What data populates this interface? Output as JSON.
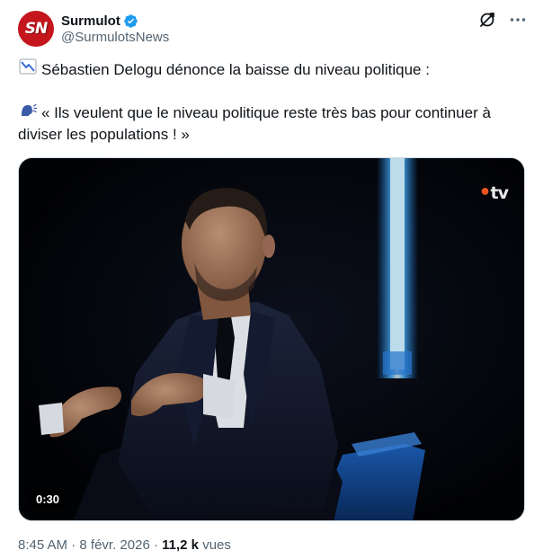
{
  "author": {
    "display_name": "Surmulot",
    "handle": "@SurmulotsNews",
    "avatar_text": "SN",
    "verified": true
  },
  "tweet": {
    "line1_emoji": "chart-decreasing-icon",
    "line1": "Sébastien Delogu dénonce la baisse du niveau politique :",
    "line2_emoji": "speaking-head-icon",
    "line2": "« Ils veulent que le niveau politique reste très bas pour continuer à diviser les populations ! »"
  },
  "media": {
    "channel_logo_dot": "•",
    "channel_logo_text": "tv",
    "duration": "0:30"
  },
  "meta": {
    "time": "8:45 AM",
    "separator1": " · ",
    "date": "8 févr. 2026",
    "separator2": " · ",
    "views_count": "11,2 k",
    "views_label": " vues"
  },
  "colors": {
    "verified_badge": "#1d9bf0",
    "avatar_bg": "#c4161c",
    "secondary_text": "#536471",
    "primary_text": "#0f1419"
  }
}
